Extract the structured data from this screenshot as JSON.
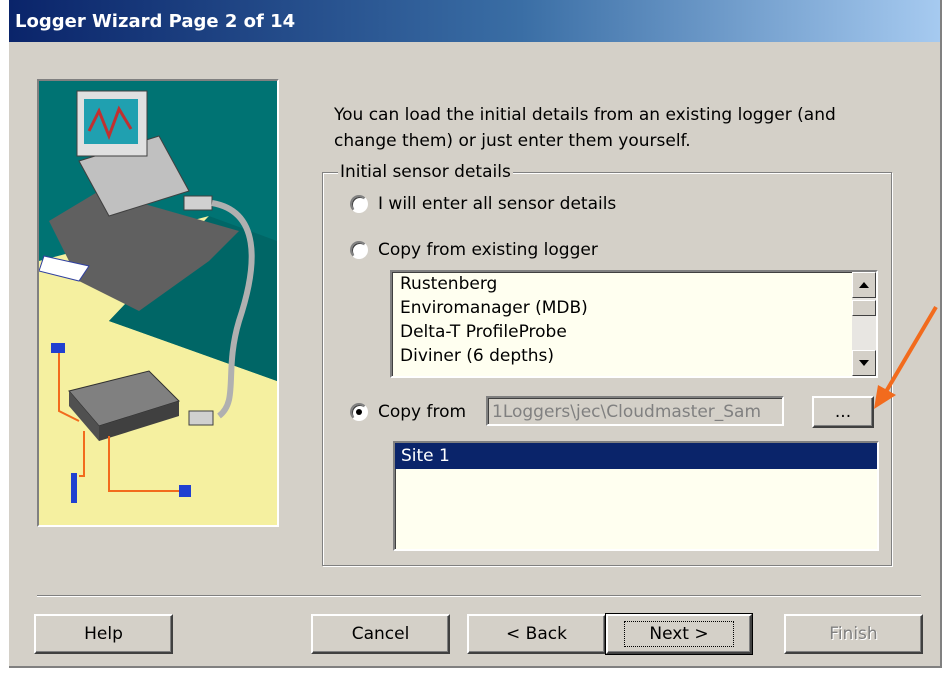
{
  "window": {
    "title": "Logger Wizard Page 2 of 14"
  },
  "intro_text": "You can load the initial details from an existing logger (and change them) or just enter them yourself.",
  "group": {
    "legend": "Initial sensor details",
    "option_manual": "I will enter all sensor details",
    "option_existing": "Copy from existing logger",
    "existing_loggers": [
      "Rustenberg",
      "Enviromanager (MDB)",
      "Delta-T ProfileProbe",
      "Diviner (6 depths)"
    ],
    "option_copy_from": "Copy from",
    "selected_option": "copy_from",
    "path_value": "1Loggers\\jec\\Cloudmaster_Sam",
    "browse_label": "...",
    "sites": [
      "Site 1"
    ]
  },
  "buttons": {
    "help": "Help",
    "cancel": "Cancel",
    "back": "< Back",
    "next": "Next >",
    "finish": "Finish"
  },
  "colors": {
    "title_bar": "#0a246a",
    "selection": "#0a246a",
    "annotation_arrow": "#f26b1d",
    "illustration_bg": "#007373"
  }
}
